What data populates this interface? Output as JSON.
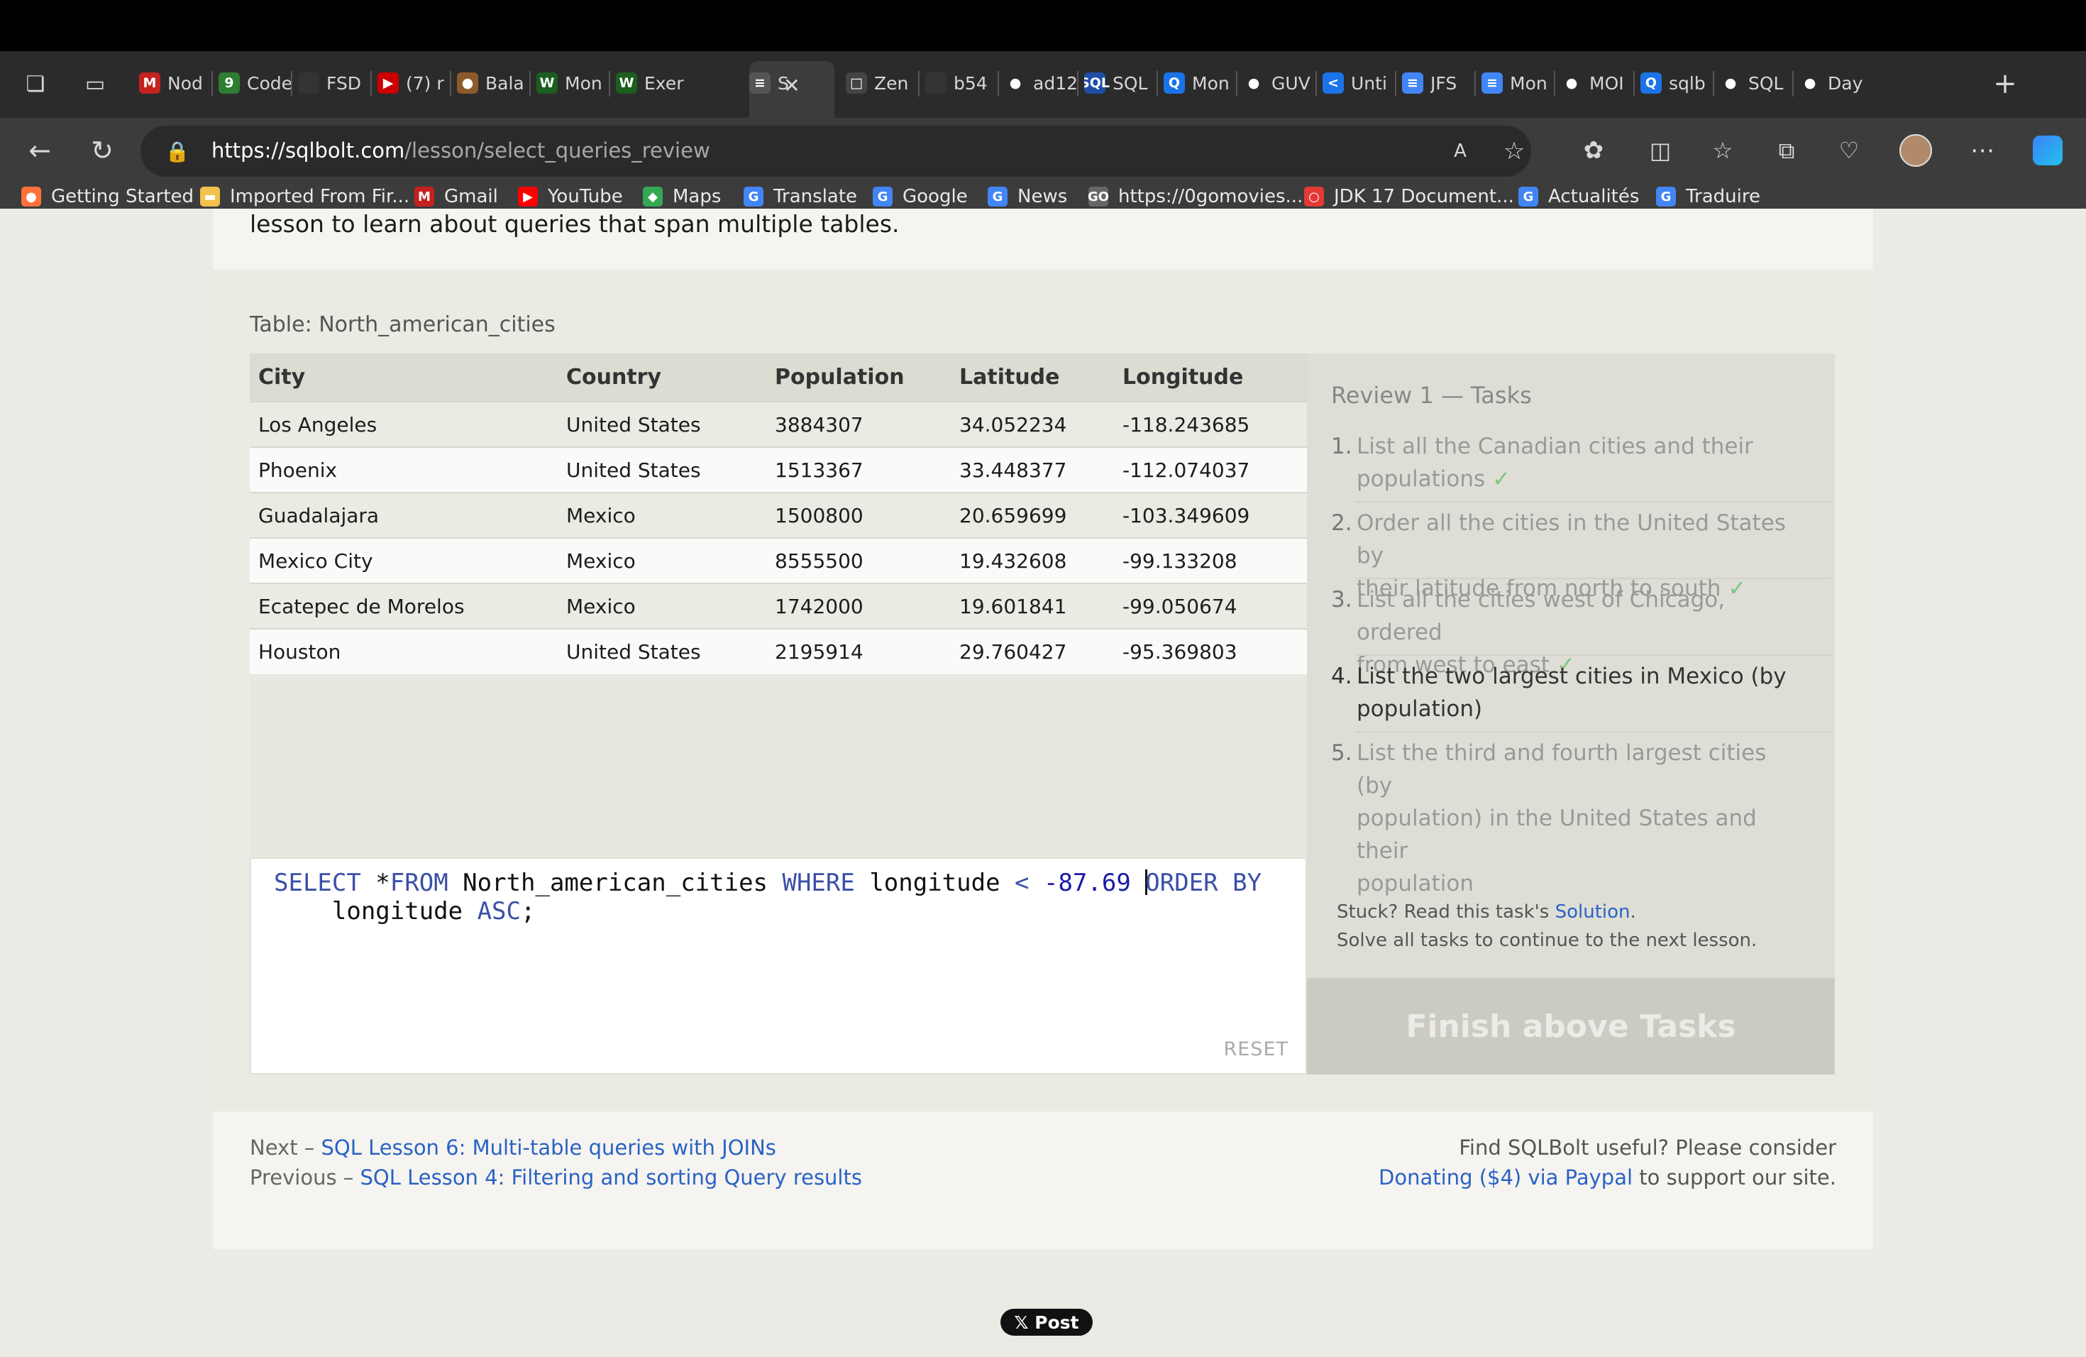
{
  "browser": {
    "tabs": [
      {
        "icon": "M",
        "color": "#c5221f",
        "label": "Nod"
      },
      {
        "icon": "9",
        "color": "#2e7d32",
        "label": "Code"
      },
      {
        "icon": "",
        "color": "#333333",
        "label": "FSD"
      },
      {
        "icon": "▶",
        "color": "#cc0000",
        "label": "(7) r"
      },
      {
        "icon": "●",
        "color": "#8d5a2b",
        "label": "Bala"
      },
      {
        "icon": "W",
        "color": "#1b5e20",
        "label": "Mon"
      },
      {
        "icon": "W",
        "color": "#1b5e20",
        "label": "Exer"
      },
      {
        "icon": "≡",
        "color": "#555555",
        "label": "S"
      },
      {
        "icon": "□",
        "color": "#444444",
        "label": "Zen"
      },
      {
        "icon": "",
        "color": "#333333",
        "label": "b54"
      },
      {
        "icon": "●",
        "color": "#ffffff",
        "label": "ad12"
      },
      {
        "icon": "SQL",
        "color": "#1e4fa8",
        "label": "SQL"
      },
      {
        "icon": "Q",
        "color": "#1a73e8",
        "label": "Mon"
      },
      {
        "icon": "●",
        "color": "#ffffff",
        "label": "GUV"
      },
      {
        "icon": "<",
        "color": "#1a73e8",
        "label": "Unti"
      },
      {
        "icon": "≡",
        "color": "#4285f4",
        "label": "JFS"
      },
      {
        "icon": "≡",
        "color": "#4285f4",
        "label": "Mon"
      },
      {
        "icon": "●",
        "color": "#ffffff",
        "label": "MOI"
      },
      {
        "icon": "Q",
        "color": "#1a73e8",
        "label": "sqlb"
      },
      {
        "icon": "●",
        "color": "#ffffff",
        "label": "SQL"
      },
      {
        "icon": "●",
        "color": "#ffffff",
        "label": "Day"
      }
    ],
    "url_host": "https://sqlbolt.com",
    "url_path": "/lesson/select_queries_review",
    "bookmarks": [
      {
        "icon": "●",
        "color": "#ff7139",
        "label": "Getting Started"
      },
      {
        "icon": "▬",
        "color": "#f2c14e",
        "label": "Imported From Fir..."
      },
      {
        "icon": "M",
        "color": "#c5221f",
        "label": "Gmail"
      },
      {
        "icon": "▶",
        "color": "#ff0000",
        "label": "YouTube"
      },
      {
        "icon": "◆",
        "color": "#34a853",
        "label": "Maps"
      },
      {
        "icon": "G",
        "color": "#4285f4",
        "label": "Translate"
      },
      {
        "icon": "G",
        "color": "#4285f4",
        "label": "Google"
      },
      {
        "icon": "G",
        "color": "#4285f4",
        "label": "News"
      },
      {
        "icon": "GO",
        "color": "#666666",
        "label": "https://0gomovies..."
      },
      {
        "icon": "○",
        "color": "#e53935",
        "label": "JDK 17 Document..."
      },
      {
        "icon": "G",
        "color": "#4285f4",
        "label": "Actualités"
      },
      {
        "icon": "G",
        "color": "#4285f4",
        "label": "Traduire"
      }
    ]
  },
  "page": {
    "intro": "lesson to learn about queries that span multiple tables.",
    "table_caption": "Table: North_american_cities",
    "table": {
      "headers": [
        "City",
        "Country",
        "Population",
        "Latitude",
        "Longitude"
      ],
      "rows": [
        [
          "Los Angeles",
          "United States",
          "3884307",
          "34.052234",
          "-118.243685"
        ],
        [
          "Phoenix",
          "United States",
          "1513367",
          "33.448377",
          "-112.074037"
        ],
        [
          "Guadalajara",
          "Mexico",
          "1500800",
          "20.659699",
          "-103.349609"
        ],
        [
          "Mexico City",
          "Mexico",
          "8555500",
          "19.432608",
          "-99.133208"
        ],
        [
          "Ecatepec de Morelos",
          "Mexico",
          "1742000",
          "19.601841",
          "-99.050674"
        ],
        [
          "Houston",
          "United States",
          "2195914",
          "29.760427",
          "-95.369803"
        ]
      ]
    },
    "editor": {
      "kw_select": "SELECT",
      "star": " *",
      "kw_from": "FROM",
      "table_name": " North_american_cities ",
      "kw_where": "WHERE",
      "col1": " longitude ",
      "op_lt": "<",
      "num": " -87.69 ",
      "kw_order_head": "O",
      "kw_order_tail": "RDER BY",
      "col2": "    longitude ",
      "kw_asc": "ASC",
      "semicolon": ";",
      "reset": "RESET"
    },
    "tasks": {
      "title": "Review 1 — Tasks",
      "items": [
        {
          "num": "1.",
          "line1": "List all the Canadian cities and their",
          "line2": "populations",
          "done": "✓"
        },
        {
          "num": "2.",
          "line1": "Order all the cities in the United States by",
          "line2": "their latitude from north to south",
          "done": "✓"
        },
        {
          "num": "3.",
          "line1": "List all the cities west of Chicago, ordered",
          "line2": "from west to east",
          "done": "✓"
        },
        {
          "num": "4.",
          "line1": "List the two largest cities in Mexico (by",
          "line2": "population)",
          "done": ""
        },
        {
          "num": "5.",
          "line1": "List the third and fourth largest cities (by",
          "line2": "population) in the United States and their",
          "line3": "population",
          "done": ""
        }
      ],
      "stuck_prefix": "Stuck? Read this task's ",
      "stuck_link": "Solution",
      "stuck_suffix": ".",
      "solve_all": "Solve all tasks to continue to the next lesson.",
      "finish_button": "Finish above Tasks"
    },
    "footer": {
      "next_prefix": "Next – ",
      "next_link": "SQL Lesson 6: Multi-table queries with JOINs",
      "prev_prefix": "Previous – ",
      "prev_link": "SQL Lesson 4: Filtering and sorting Query results",
      "donate_line1": "Find SQLBolt useful? Please consider",
      "donate_link": "Donating ($4) via Paypal",
      "donate_suffix": " to support our site."
    },
    "x_post": "𝕏 Post"
  }
}
